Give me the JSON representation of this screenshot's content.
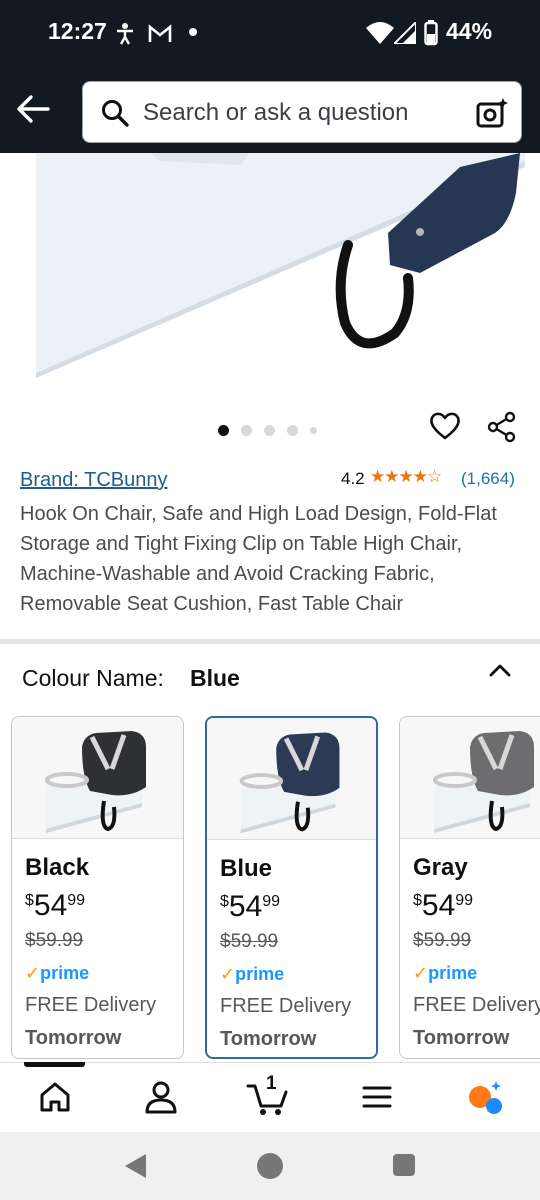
{
  "status_bar": {
    "time": "12:27",
    "battery": "44%"
  },
  "search": {
    "placeholder": "Search or ask a question"
  },
  "product": {
    "brand": "Brand: TCBunny",
    "rating": "4.2",
    "stars": "★★★★☆",
    "rating_count": "(1,664)",
    "title": "Hook On Chair, Safe and High Load Design, Fold-Flat Storage and Tight Fixing Clip on Table High Chair, Machine-Washable and Avoid Cracking Fabric, Removable Seat Cushion, Fast Table Chair"
  },
  "colour": {
    "label": "Colour Name:",
    "value": "Blue"
  },
  "variants": [
    {
      "name": "Black",
      "currency": "$",
      "price_whole": "54",
      "price_cents": "99",
      "was": "$59.99",
      "prime": "prime",
      "delivery": "FREE Delivery",
      "date": "Tomorrow",
      "seat_color": "#2f3033"
    },
    {
      "name": "Blue",
      "currency": "$",
      "price_whole": "54",
      "price_cents": "99",
      "was": "$59.99",
      "prime": "prime",
      "delivery": "FREE Delivery",
      "date": "Tomorrow",
      "seat_color": "#2c3a55"
    },
    {
      "name": "Gray",
      "currency": "$",
      "price_whole": "54",
      "price_cents": "99",
      "was": "$59.99",
      "prime": "prime",
      "delivery": "FREE Delivery",
      "date": "Tomorrow",
      "seat_color": "#6d6d6f"
    }
  ],
  "cart": {
    "count": "1"
  },
  "icons": [
    "back-arrow-icon",
    "search-icon",
    "camera-icon",
    "heart-icon",
    "share-icon",
    "chevron-up-icon",
    "home-icon",
    "account-icon",
    "cart-icon",
    "menu-icon",
    "rufus-icon"
  ],
  "colors": {
    "header": "#131921",
    "link": "#1f5e8a",
    "selected_border": "#2e6aa1",
    "star": "#e47911",
    "prime": "#1a98ff"
  }
}
